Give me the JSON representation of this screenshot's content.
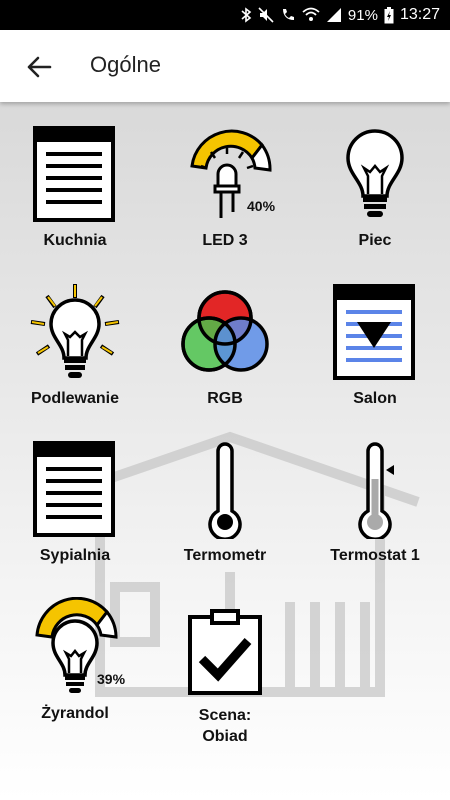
{
  "status": {
    "battery": "91%",
    "time": "13:27"
  },
  "header": {
    "title": "Ogólne"
  },
  "tiles": [
    {
      "label": "Kuchnia"
    },
    {
      "label": "LED 3",
      "percent": "40%"
    },
    {
      "label": "Piec"
    },
    {
      "label": "Podlewanie"
    },
    {
      "label": "RGB"
    },
    {
      "label": "Salon"
    },
    {
      "label": "Sypialnia"
    },
    {
      "label": "Termometr"
    },
    {
      "label": "Termostat 1"
    },
    {
      "label": "Żyrandol",
      "percent": "39%"
    },
    {
      "label": "Scena:\nObiad"
    }
  ],
  "colors": {
    "accent_yellow": "#f5c400",
    "blind_blue": "#5b84e8",
    "rgb_red": "#e21b1b",
    "rgb_green": "#4cc24c",
    "rgb_blue": "#5b8de8"
  }
}
